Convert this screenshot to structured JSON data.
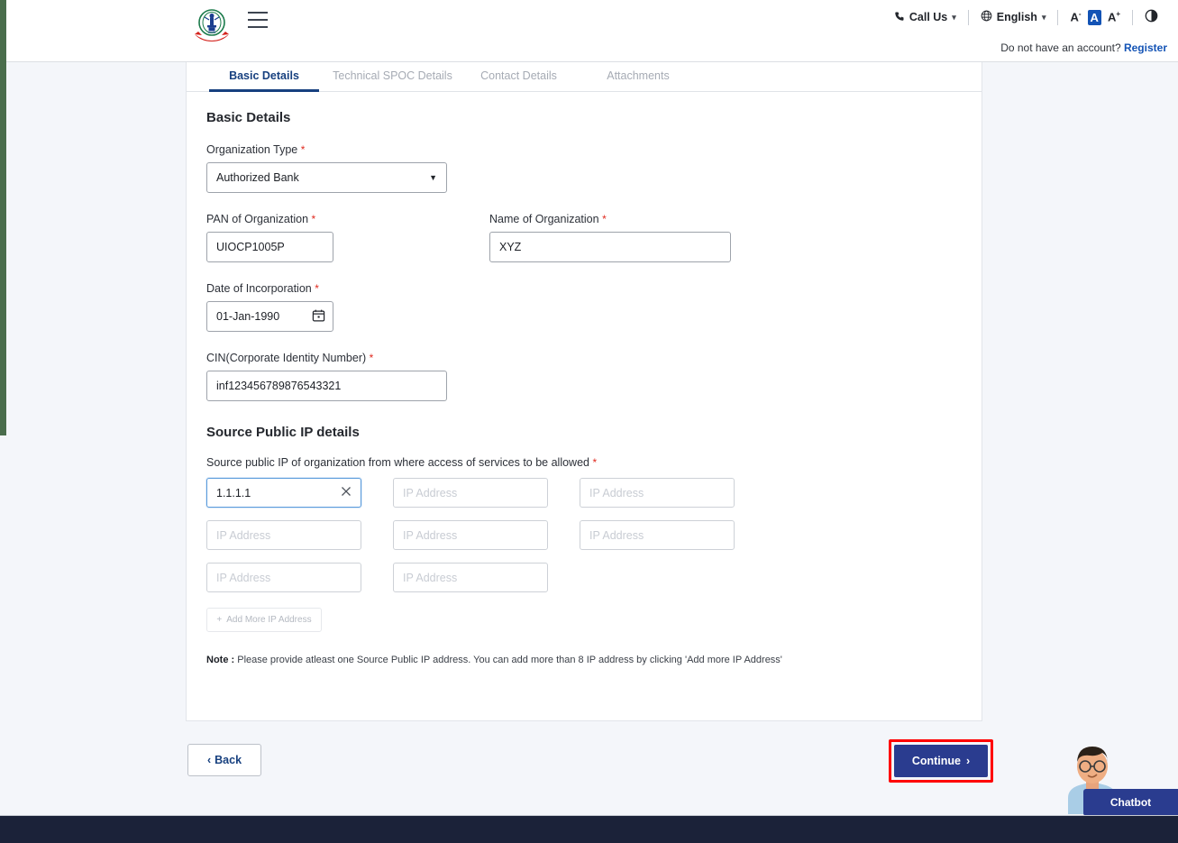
{
  "header": {
    "logo_alt": "national-emblem-logo",
    "menu_icon": "hamburger-icon",
    "call_us": "Call Us",
    "call_icon": "phone-icon",
    "language": "English",
    "globe_icon": "globe-icon",
    "font_decrease": "A",
    "font_normal": "A",
    "font_increase": "A",
    "contrast_icon": "contrast-icon",
    "account_prompt": "Do not have an account?",
    "register": "Register"
  },
  "tabs": [
    {
      "label": "Basic Details",
      "active": true
    },
    {
      "label": "Technical SPOC Details",
      "active": false
    },
    {
      "label": "Contact Details",
      "active": false
    },
    {
      "label": "Attachments",
      "active": false
    }
  ],
  "form": {
    "section_title": "Basic Details",
    "organization_type": {
      "label": "Organization Type",
      "required": "*",
      "value": "Authorized Bank"
    },
    "pan": {
      "label": "PAN of Organization",
      "required": "*",
      "value": "UIOCP1005P"
    },
    "org_name": {
      "label": "Name of Organization",
      "required": "*",
      "value": "XYZ"
    },
    "date_of_incorporation": {
      "label": "Date of Incorporation",
      "required": "*",
      "value": "01-Jan-1990",
      "icon": "calendar-icon"
    },
    "cin": {
      "label": "CIN(Corporate Identity Number)",
      "required": "*",
      "value": "inf123456789876543321"
    }
  },
  "ip_section": {
    "title": "Source Public IP details",
    "label": "Source public IP of organization from where access of services to be allowed",
    "required": "*",
    "placeholder": "IP Address",
    "values": [
      "1.1.1.1",
      "",
      "",
      "",
      "",
      "",
      "",
      ""
    ],
    "clear_icon": "clear-x-icon",
    "add_more_label": "Add More IP Address",
    "add_more_icon": "plus-icon",
    "note_prefix": "Note :",
    "note_text": " Please provide atleast one Source Public IP address. You can add more than 8 IP address by clicking 'Add more IP Address'"
  },
  "footer_actions": {
    "back": "Back",
    "back_icon": "chevron-left-icon",
    "continue": "Continue",
    "continue_icon": "chevron-right-icon",
    "highlight_color": "#ff0000",
    "continue_color": "#2a3c8f"
  },
  "chatbot": {
    "label": "Chatbot",
    "avatar_icon": "chatbot-avatar-icon"
  },
  "colors": {
    "accent_blue": "#17407f",
    "required_red": "#e02a1f",
    "page_bg": "#f4f6fa",
    "footer_bg": "#1b2239",
    "edge_green": "#4a6d4c"
  }
}
